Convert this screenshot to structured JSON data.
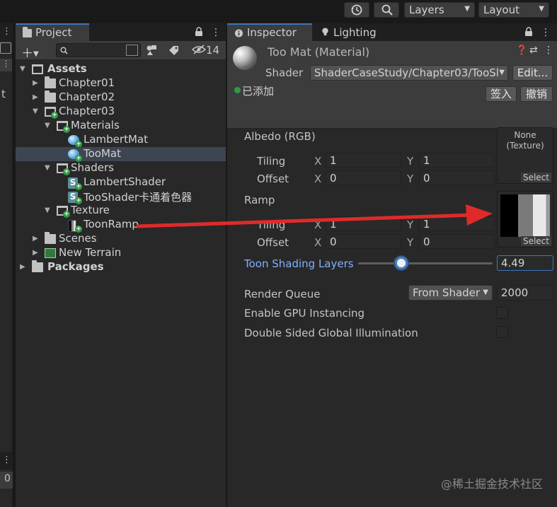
{
  "toolbar": {
    "layers_label": "Layers",
    "layout_label": "Layout"
  },
  "left_sliver": {
    "partial_text": "t",
    "bottom_count": "0"
  },
  "project": {
    "tab_label": "Project",
    "hidden_count": "14",
    "tree": [
      {
        "label": "Assets"
      },
      {
        "label": "Chapter01"
      },
      {
        "label": "Chapter02"
      },
      {
        "label": "Chapter03"
      },
      {
        "label": "Materials"
      },
      {
        "label": "LambertMat"
      },
      {
        "label": "TooMat"
      },
      {
        "label": "Shaders"
      },
      {
        "label": "LambertShader"
      },
      {
        "label": "TooShader卡通着色器"
      },
      {
        "label": "Texture"
      },
      {
        "label": "ToonRamp"
      },
      {
        "label": "Scenes"
      },
      {
        "label": "New Terrain"
      },
      {
        "label": "Packages"
      }
    ]
  },
  "inspector": {
    "tab_inspector": "Inspector",
    "tab_lighting": "Lighting",
    "title": "Too Mat (Material)",
    "shader_label": "Shader",
    "shader_value": "ShaderCaseStudy/Chapter03/TooSl",
    "edit_button": "Edit...",
    "vcs_status": "已添加",
    "checkin_button": "签入",
    "revert_button": "撤销",
    "albedo_label": "Albedo (RGB)",
    "albedo_slot_text": "None\n(Texture)",
    "select_label": "Select",
    "tiling_label": "Tiling",
    "offset_label": "Offset",
    "x_label": "X",
    "y_label": "Y",
    "albedo_tiling_x": "1",
    "albedo_tiling_y": "1",
    "albedo_offset_x": "0",
    "albedo_offset_y": "0",
    "ramp_label": "Ramp",
    "ramp_tiling_x": "1",
    "ramp_tiling_y": "1",
    "ramp_offset_x": "0",
    "ramp_offset_y": "0",
    "toon_layers_label": "Toon Shading Layers",
    "toon_layers_value": "4.49",
    "toon_layers_fraction": 0.32,
    "render_queue_label": "Render Queue",
    "render_queue_dropdown": "From Shader",
    "render_queue_value": "2000",
    "gpu_instancing_label": "Enable GPU Instancing",
    "double_sided_gi_label": "Double Sided Global Illumination"
  },
  "watermark": "@稀土掘金技术社区",
  "colors": {
    "accent_blue": "#3a79bb",
    "slider_label_blue": "#7fb1ff",
    "arrow_red": "#e02a2a",
    "vcs_green": "#2f9a43"
  }
}
